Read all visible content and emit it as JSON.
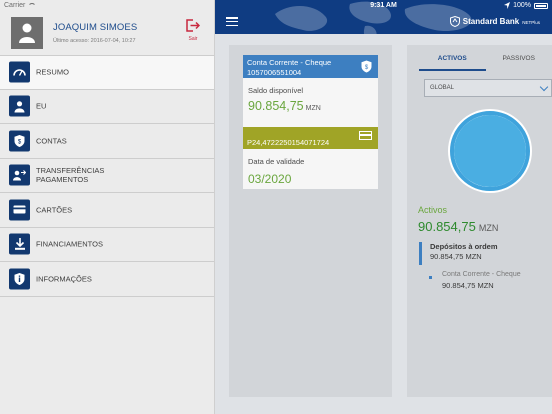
{
  "status_bar": {
    "carrier": "Carrier",
    "time": "9:31 AM",
    "battery": "100%"
  },
  "profile": {
    "name": "JOAQUIM SIMOES",
    "last_access": "Último acesso: 2016-07-04, 10:27",
    "logout_label": "Sair"
  },
  "menu": {
    "items": [
      {
        "label": "RESUMO",
        "icon": "gauge-icon",
        "active": true
      },
      {
        "label": "EU",
        "icon": "person-icon",
        "active": false
      },
      {
        "label": "CONTAS",
        "icon": "shield-icon",
        "active": false
      },
      {
        "label": "TRANSFERÊNCIAS\nPAGAMENTOS",
        "icon": "transfer-icon",
        "active": false
      },
      {
        "label": "CARTÕES",
        "icon": "card-icon",
        "active": false
      },
      {
        "label": "FINANCIAMENTOS",
        "icon": "download-icon",
        "active": false
      },
      {
        "label": "INFORMAÇÕES",
        "icon": "info-icon",
        "active": false
      }
    ]
  },
  "header": {
    "brand_name": "Standard Bank",
    "brand_sub": "NETPlus"
  },
  "account": {
    "type": "Conta Corrente - Cheque",
    "number": "1057006551004",
    "balance_label": "Saldo disponível",
    "balance": "90.854,75",
    "currency": "MZN"
  },
  "card": {
    "number": "P24,4722250154071724",
    "validity_label": "Data de validade",
    "validity": "03/2020"
  },
  "summary": {
    "tabs": [
      "ACTIVOS",
      "PASSIVOS"
    ],
    "filter": "GLOBAL",
    "title": "Activos",
    "total": "90.854,75",
    "currency": "MZN",
    "group": {
      "title": "Depósitos à ordem",
      "amount": "90.854,75 MZN"
    },
    "items": [
      {
        "name": "Conta Corrente - Cheque",
        "amount": "90.854,75 MZN"
      }
    ]
  },
  "colors": {
    "primary": "#0f3c82",
    "accent": "#3d7fc1",
    "positive": "#6aa63e",
    "card_band": "#a0a426",
    "danger": "#c8283e"
  }
}
